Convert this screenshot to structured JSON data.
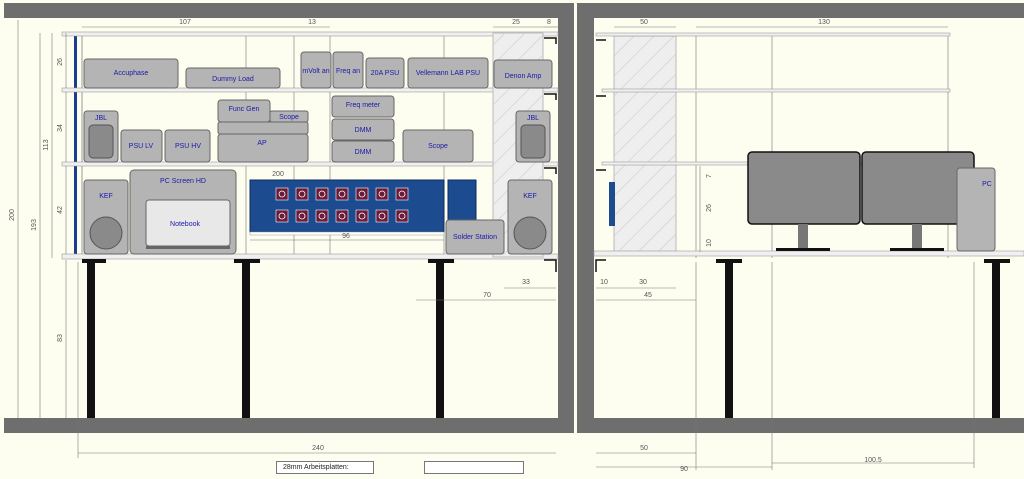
{
  "colors": {
    "background": "#fefef0",
    "wall": "#6e6e6e",
    "shelf": "#f0f0f0",
    "device_fill": "#b4b4b4",
    "label": "#1a1aa8",
    "patch_panel": "#1d4b8f",
    "leg": "#111111",
    "dim_line": "#777777"
  },
  "dimensions": {
    "top_107": "107",
    "top_13": "13",
    "top_25": "25",
    "top_8": "8",
    "top_50": "50",
    "top_130": "130",
    "left_200": "200",
    "left_193": "193",
    "left_113": "113",
    "left_26": "26",
    "left_34": "34",
    "left_42": "42",
    "left_83": "83",
    "mid_200": "200",
    "mid_96": "96",
    "mid_33": "33",
    "mid_70": "70",
    "right_10a": "10",
    "right_30": "30",
    "right_45": "45",
    "right_7": "7",
    "right_26": "26",
    "right_10b": "10",
    "bottom_240": "240",
    "bottom_50": "50",
    "bottom_90": "90",
    "bottom_100_5": "100.5"
  },
  "devices": {
    "accuphase": "Accuphase",
    "dummy_load": "Dummy Load",
    "mvolt": "mVolt an",
    "freq_an": "Freq an",
    "psu_20a": "20A PSU",
    "velleman": "Vellemann LAB PSU",
    "denon": "Denon Amp",
    "jbl_left": "JBL",
    "psu_lv": "PSU LV",
    "psu_hv": "PSU HV",
    "func_gen": "Func Gen",
    "scope_small": "Scope",
    "ap": "AP",
    "freq_meter": "Freq meter",
    "dmm_1": "DMM",
    "dmm_2": "DMM",
    "scope": "Scope",
    "jbl_right": "JBL",
    "kef_left": "KEF",
    "pc_screen": "PC Screen HD",
    "notebook": "Notebook",
    "solder_station": "Solder Station",
    "kef_right": "KEF",
    "pc": "PC"
  },
  "notes": {
    "worktop": "28mm Arbeitsplatten:"
  }
}
